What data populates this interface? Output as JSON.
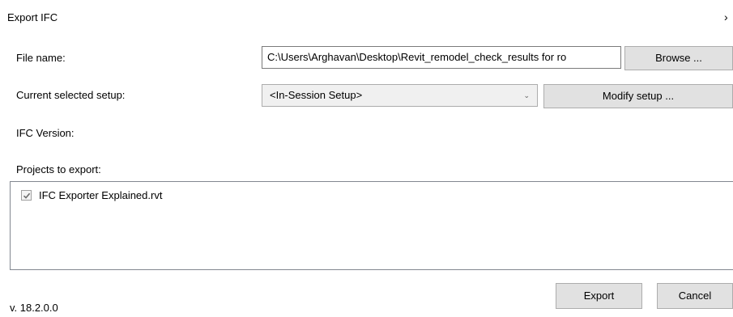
{
  "dialog": {
    "title": "Export IFC",
    "close_glyph": "›"
  },
  "file_name": {
    "label": "File name:",
    "value": "C:\\Users\\Arghavan\\Desktop\\Revit_remodel_check_results for ro",
    "browse_label": "Browse ..."
  },
  "setup": {
    "label": "Current selected setup:",
    "selected": "<In-Session Setup>",
    "modify_label": "Modify setup ..."
  },
  "ifc_version": {
    "label": "IFC Version:"
  },
  "projects": {
    "label": "Projects to export:",
    "items": [
      {
        "label": "IFC Exporter Explained.rvt",
        "checked": true
      }
    ]
  },
  "footer": {
    "version": "v. 18.2.0.0",
    "export_label": "Export",
    "cancel_label": "Cancel"
  }
}
